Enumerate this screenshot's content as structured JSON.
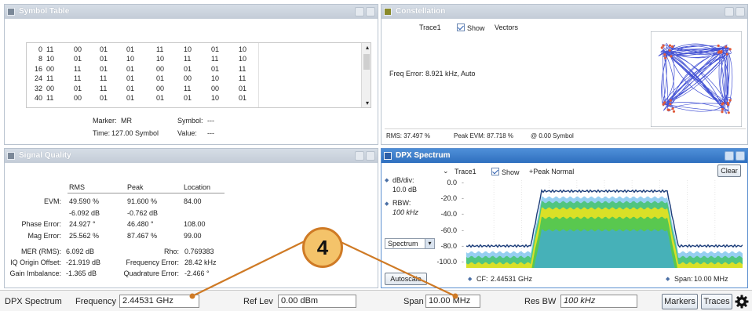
{
  "symbol_table": {
    "title": "Symbol Table",
    "rows": [
      {
        "index": "0",
        "values": [
          "11",
          "00",
          "01",
          "01",
          "11",
          "10",
          "01",
          "10"
        ]
      },
      {
        "index": "8",
        "values": [
          "10",
          "01",
          "01",
          "10",
          "10",
          "11",
          "11",
          "10"
        ]
      },
      {
        "index": "16",
        "values": [
          "00",
          "11",
          "01",
          "01",
          "00",
          "01",
          "01",
          "11"
        ]
      },
      {
        "index": "24",
        "values": [
          "11",
          "11",
          "11",
          "01",
          "01",
          "00",
          "10",
          "11"
        ]
      },
      {
        "index": "32",
        "values": [
          "00",
          "01",
          "11",
          "01",
          "00",
          "11",
          "00",
          "01"
        ]
      },
      {
        "index": "40",
        "values": [
          "11",
          "00",
          "01",
          "01",
          "01",
          "01",
          "10",
          "01"
        ]
      }
    ],
    "marker_label": "Marker:",
    "marker_value": "MR",
    "symbol_label": "Symbol:",
    "symbol_value": "---",
    "time_label": "Time:",
    "time_value": "127.00 Symbol",
    "value_label": "Value:",
    "value_value": "---"
  },
  "constellation": {
    "title": "Constellation",
    "trace": "Trace1",
    "show_label": "Show",
    "vectors_label": "Vectors",
    "freq_error": "Freq Error: 8.921 kHz, Auto",
    "rms": "RMS:  37.497 %",
    "peak_evm": "Peak EVM:   87.718 %",
    "at_symbol": "@  0.00 Symbol",
    "colors": {
      "trace": "#2233cc",
      "points": "#e05a3a"
    }
  },
  "signal_quality": {
    "title": "Signal Quality",
    "headers": [
      "RMS",
      "Peak",
      "Location"
    ],
    "rows": [
      {
        "label": "EVM:",
        "rms": "49.590 %",
        "peak": "91.600 %",
        "location": "84.00"
      },
      {
        "label": "",
        "rms": "-6.092 dB",
        "peak": "-0.762 dB",
        "location": ""
      },
      {
        "label": "Phase Error:",
        "rms": "24.927 °",
        "peak": "46.480 °",
        "location": "108.00"
      },
      {
        "label": "Mag Error:",
        "rms": "25.562 %",
        "peak": "87.467 %",
        "location": "99.00"
      }
    ],
    "extra": [
      {
        "l1": "MER (RMS):",
        "v1": "6.092 dB",
        "l2": "Rho:",
        "v2": "0.769383"
      },
      {
        "l1": "IQ Origin Offset:",
        "v1": "-21.919 dB",
        "l2": "Frequency Error:",
        "v2": "28.42 kHz"
      },
      {
        "l1": "Gain Imbalance:",
        "v1": "-1.365 dB",
        "l2": "Quadrature Error:",
        "v2": "-2.466 °"
      }
    ]
  },
  "dpx": {
    "title": "DPX Spectrum",
    "trace": "Trace1",
    "show_label": "Show",
    "mode": "+Peak Normal",
    "clear_label": "Clear",
    "dbdiv_label": "dB/div:",
    "dbdiv_value": "10.0 dB",
    "rbw_label": "RBW:",
    "rbw_value": "100 kHz",
    "ticks": [
      "0.0",
      "-20.0",
      "-40.0",
      "-60.0",
      "-80.0",
      "-100.0"
    ],
    "view_select": "Spectrum",
    "autoscale_label": "Autoscale",
    "cf_label": "CF:",
    "cf_value": "2.44531 GHz",
    "span_label": "Span:",
    "span_value": "10.00 MHz",
    "colors": {
      "background": "#ffffff",
      "peak_trace": "#1c3d7a",
      "hot": "#f2e418",
      "warm": "#38c25a",
      "cool": "#3fa7e6"
    }
  },
  "bottom_bar": {
    "app_label": "DPX Spectrum",
    "frequency_label": "Frequency",
    "frequency_value": "2.44531 GHz",
    "reflev_label": "Ref Lev",
    "reflev_value": "0.00 dBm",
    "span_label": "Span",
    "span_value": "10.00 MHz",
    "resbw_label": "Res BW",
    "resbw_value": "100 kHz",
    "markers_label": "Markers",
    "traces_label": "Traces"
  },
  "callout": {
    "label": "4",
    "color": "#cf7a25"
  }
}
